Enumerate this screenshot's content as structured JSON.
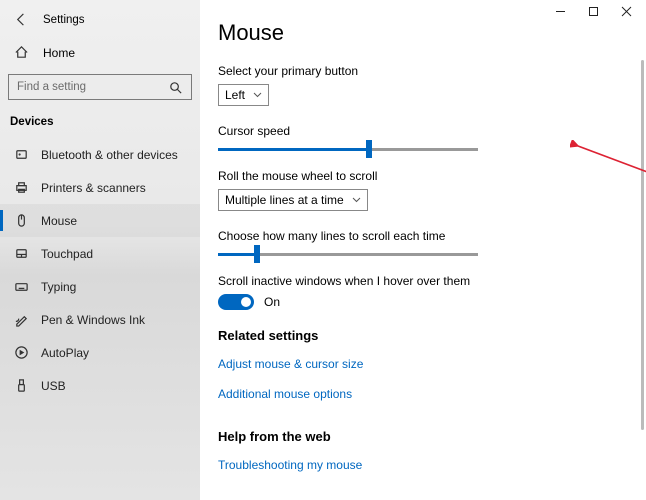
{
  "window": {
    "title": "Settings"
  },
  "sidebar": {
    "home": "Home",
    "search_placeholder": "Find a setting",
    "category": "Devices",
    "items": [
      {
        "label": "Bluetooth & other devices"
      },
      {
        "label": "Printers & scanners"
      },
      {
        "label": "Mouse",
        "selected": true
      },
      {
        "label": "Touchpad"
      },
      {
        "label": "Typing"
      },
      {
        "label": "Pen & Windows Ink"
      },
      {
        "label": "AutoPlay"
      },
      {
        "label": "USB"
      }
    ]
  },
  "main": {
    "title": "Mouse",
    "primary_button_label": "Select your primary button",
    "primary_button_value": "Left",
    "cursor_speed_label": "Cursor speed",
    "cursor_speed_value": 58,
    "wheel_label": "Roll the mouse wheel to scroll",
    "wheel_value": "Multiple lines at a time",
    "lines_label": "Choose how many lines to scroll each time",
    "lines_value": 15,
    "inactive_label": "Scroll inactive windows when I hover over them",
    "inactive_state": "On",
    "related_header": "Related settings",
    "related_links": [
      "Adjust mouse & cursor size",
      "Additional mouse options"
    ],
    "help_header": "Help from the web",
    "help_links": [
      "Troubleshooting my mouse"
    ]
  }
}
